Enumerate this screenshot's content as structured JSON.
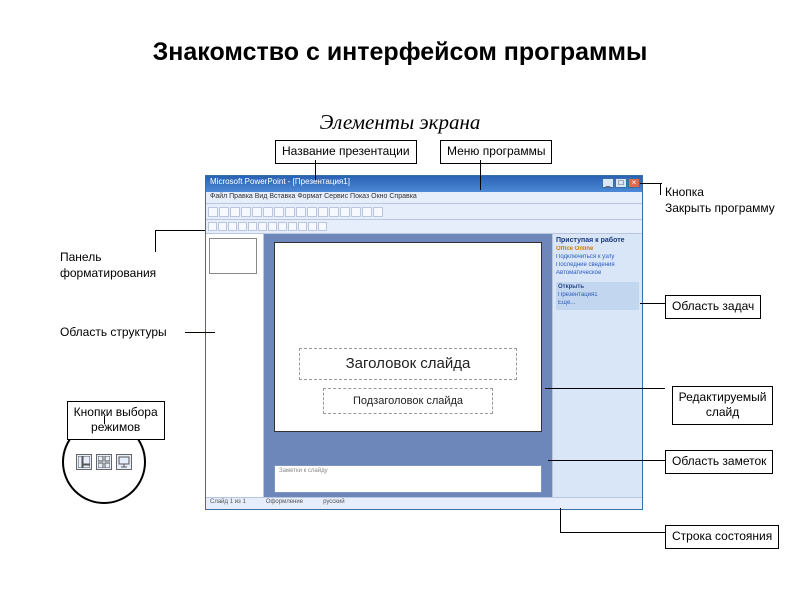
{
  "page": {
    "title": "Знакомство с интерфейсом программы",
    "subtitle": "Элементы экрана"
  },
  "callouts": {
    "presentation_name": "Название презентации",
    "program_menu": "Меню программы",
    "close_button": "Кнопка\nЗакрыть программу",
    "format_panel": "Панель\nформатирования",
    "task_pane": "Область задач",
    "outline_area": "Область  структуры",
    "editing_slide": "Редактируемый\nслайд",
    "view_buttons": "Кнопки выбора\nрежимов",
    "notes_area": "Область заметок",
    "status_bar": "Строка состояния"
  },
  "ppwin": {
    "title": "Microsoft PowerPoint - [Презентация1]",
    "menu": "Файл  Правка  Вид  Вставка  Формат  Сервис  Показ  Окно  Справка",
    "slide_title_placeholder": "Заголовок слайда",
    "slide_sub_placeholder": "Подзаголовок слайда",
    "notes_placeholder": "Заметки к слайду",
    "taskpane": {
      "header": "Приступая к работе",
      "office": "Office Online",
      "lines": [
        "Подключиться к узлу",
        "Последние сведения",
        "Автоматическое"
      ],
      "open_header": "Открыть",
      "open_items": [
        "Презентация1",
        "Ещё..."
      ]
    },
    "status": {
      "slide": "Слайд 1 из 1",
      "template": "Оформление",
      "lang": "русский"
    }
  }
}
